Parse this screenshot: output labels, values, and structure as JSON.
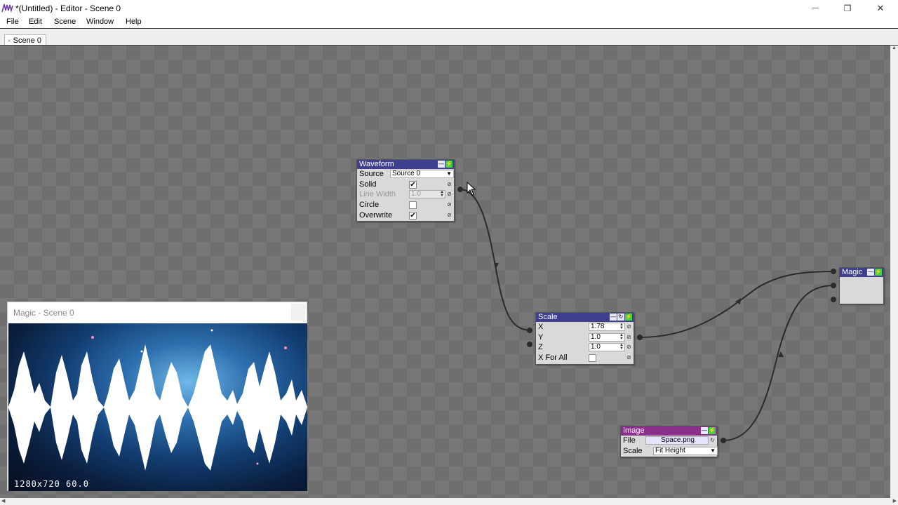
{
  "window": {
    "title": "*(Untitled) - Editor - Scene 0",
    "minimize_glyph": "—",
    "maximize_glyph": "❐",
    "close_glyph": "✕"
  },
  "menu": [
    "File",
    "Edit",
    "Scene",
    "Window",
    "Help"
  ],
  "tabs": [
    {
      "label": "Scene 0",
      "close_glyph": "×"
    }
  ],
  "nodes": {
    "waveform": {
      "title": "Waveform",
      "header_color": "#3f3f8f",
      "rows": {
        "source": {
          "label": "Source",
          "value": "Source 0"
        },
        "solid": {
          "label": "Solid",
          "checked": true
        },
        "line_width": {
          "label": "Line Width",
          "value": "1.0",
          "disabled": true
        },
        "circle": {
          "label": "Circle",
          "checked": false
        },
        "overwrite": {
          "label": "Overwrite",
          "checked": true
        }
      }
    },
    "scale": {
      "title": "Scale",
      "header_color": "#3f3f8f",
      "rows": {
        "x": {
          "label": "X",
          "value": "1.78"
        },
        "y": {
          "label": "Y",
          "value": "1.0"
        },
        "z": {
          "label": "Z",
          "value": "1.0"
        },
        "x_for_all": {
          "label": "X For All",
          "checked": false
        }
      }
    },
    "magic": {
      "title": "Magic",
      "header_color": "#3f3f8f"
    },
    "image": {
      "title": "Image",
      "header_color": "#8a2f8a",
      "rows": {
        "file": {
          "label": "File",
          "value": "Space.png"
        },
        "scale": {
          "label": "Scale",
          "value": "Fit Height"
        }
      }
    }
  },
  "preview": {
    "title": "Magic - Scene 0",
    "status": "1280x720  60.0"
  },
  "icons": {
    "minimize": "minimize-icon",
    "enable": "enable-icon",
    "update": "update-icon",
    "link": "link-icon",
    "dropdown": "chevron-down-icon",
    "checkmark": "check-icon"
  }
}
